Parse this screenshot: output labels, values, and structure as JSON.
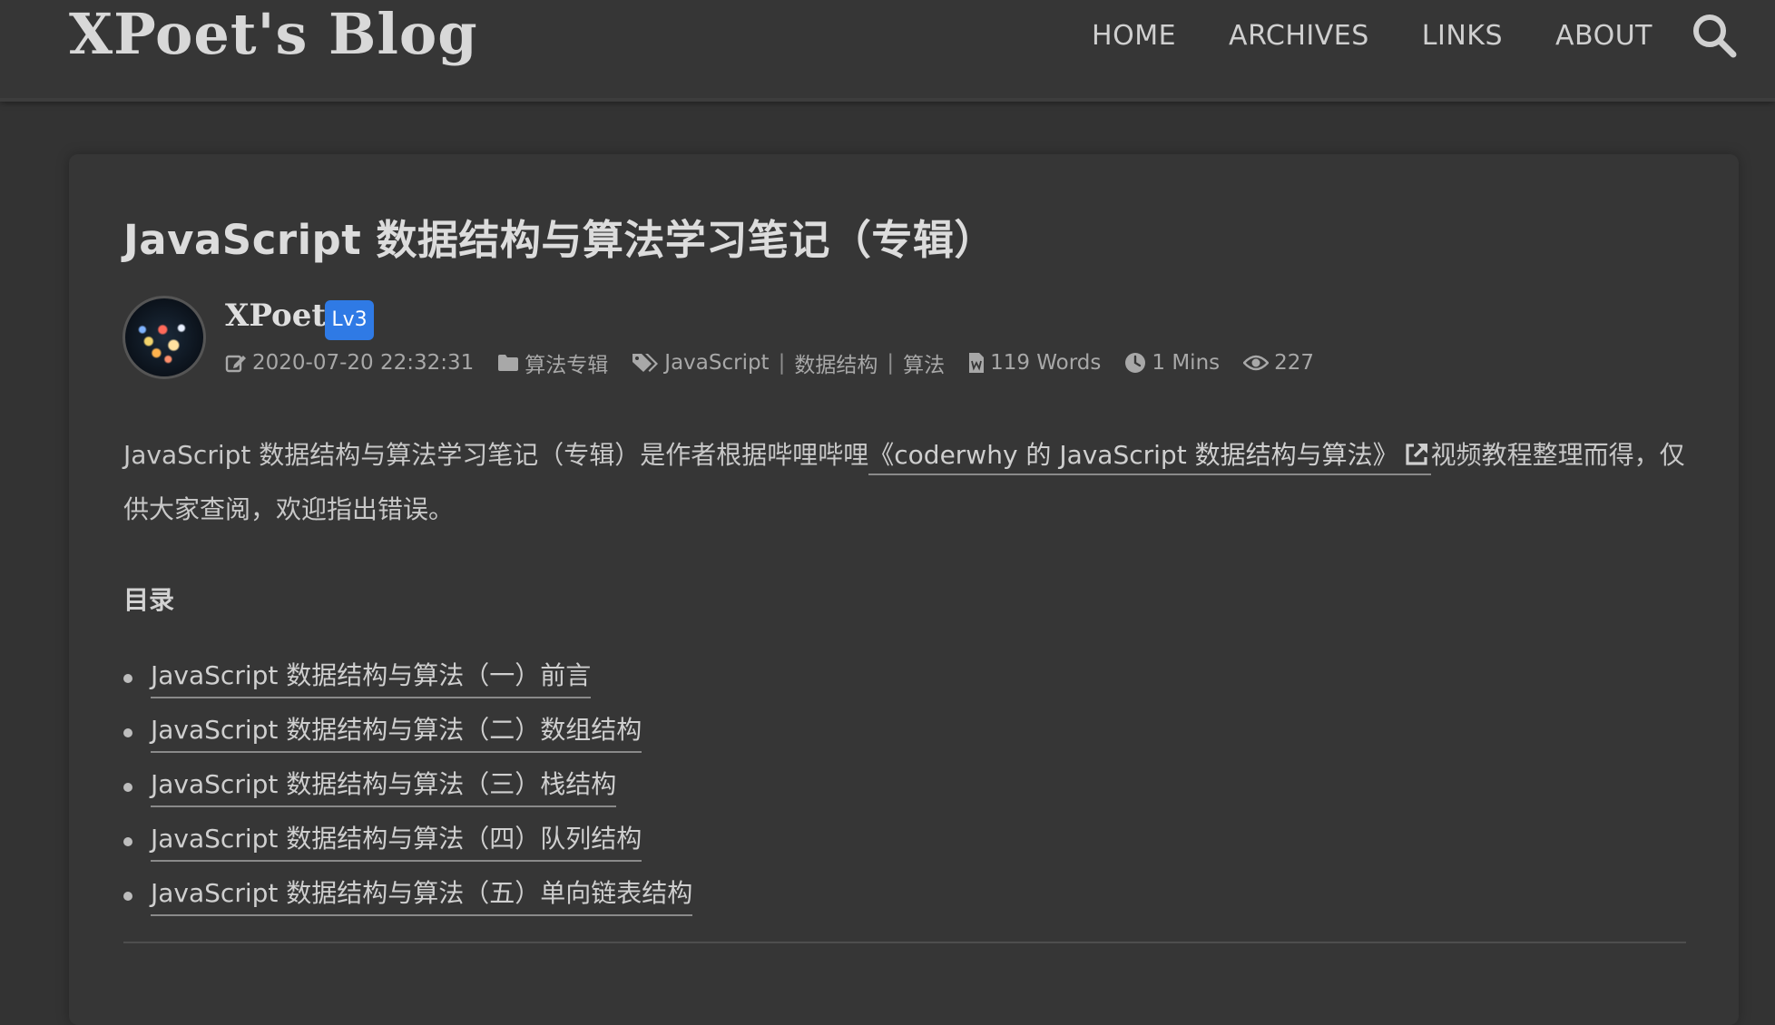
{
  "header": {
    "logo": "XPoet's Blog",
    "nav": [
      "HOME",
      "ARCHIVES",
      "LINKS",
      "ABOUT"
    ],
    "search_icon": "search-icon"
  },
  "post": {
    "title": "JavaScript 数据结构与算法学习笔记（专辑）",
    "author": "XPoet",
    "level": "Lv3",
    "date": "2020-07-20 22:32:31",
    "category": "算法专辑",
    "tags": [
      "JavaScript",
      "数据结构",
      "算法"
    ],
    "words": "119 Words",
    "read_time": "1 Mins",
    "views": "227",
    "intro_before": "JavaScript 数据结构与算法学习笔记（专辑）是作者根据哔哩哔哩",
    "intro_link": "《coderwhy 的 JavaScript 数据结构与算法》",
    "intro_after": "视频教程整理而得，仅供大家查阅，欢迎指出错误。",
    "toc_heading": "目录",
    "toc": [
      "JavaScript 数据结构与算法（一）前言",
      "JavaScript 数据结构与算法（二）数组结构",
      "JavaScript 数据结构与算法（三）栈结构",
      "JavaScript 数据结构与算法（四）队列结构",
      "JavaScript 数据结构与算法（五）单向链表结构"
    ]
  },
  "colors": {
    "background": "#333333",
    "badge": "#2f7ae5"
  }
}
